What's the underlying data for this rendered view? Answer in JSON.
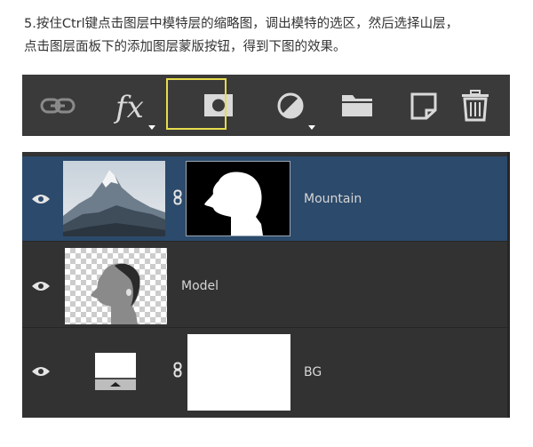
{
  "instructions": {
    "line1": "5.按住Ctrl键点击图层中模特层的缩略图，调出模特的选区，然后选择山层，",
    "line2": "点击图层面板下的添加图层蒙版按钮，得到下图的效果。"
  },
  "toolbar": {
    "buttons": [
      {
        "icon": "link-layers-icon"
      },
      {
        "icon": "fx-icon",
        "label": "fx",
        "has_dropdown": true
      },
      {
        "icon": "add-layer-mask-icon",
        "highlighted": true
      },
      {
        "icon": "adjustment-layer-icon",
        "has_dropdown": true
      },
      {
        "icon": "folder-icon"
      },
      {
        "icon": "new-layer-icon"
      },
      {
        "icon": "trash-icon"
      }
    ],
    "highlight_color": "#e6dc4c"
  },
  "layers": [
    {
      "name": "Mountain",
      "selected": true,
      "visible": true,
      "has_mask": true
    },
    {
      "name": "Model",
      "selected": false,
      "visible": true,
      "has_mask": false
    },
    {
      "name": "BG",
      "selected": false,
      "visible": true,
      "has_mask": true
    }
  ],
  "colors": {
    "toolbar_bg": "#3a3a3a",
    "panel_bg": "#323232",
    "selected_row": "#2c4a6b",
    "icon": "#d9d9d9",
    "dim_icon": "#8a8a8a"
  }
}
